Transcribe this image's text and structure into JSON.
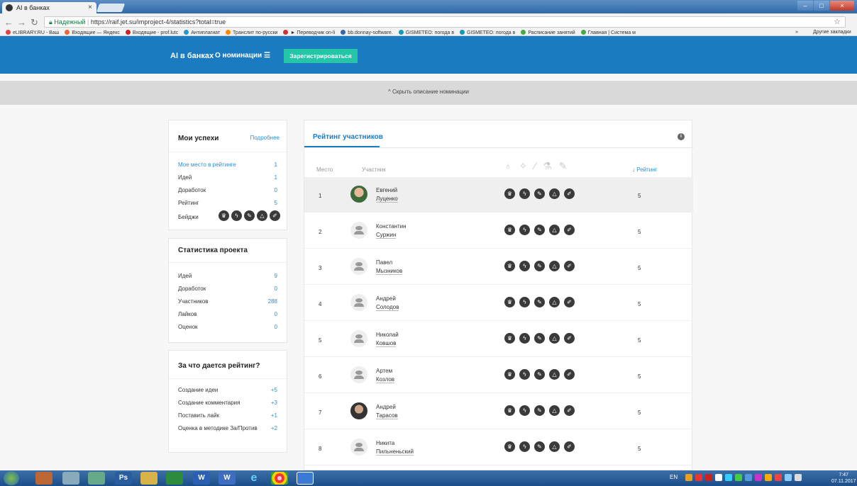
{
  "browser": {
    "tab_title": "AI в банках",
    "tab_close": "×",
    "url_secure_label": "Надежный",
    "url": "https://raif.jet.su/improject-4/statistics?total=true",
    "bookmarks": [
      {
        "label": "eLIBRARY.RU - Ваш",
        "color": "#d44"
      },
      {
        "label": "Входящие — Яндекс",
        "color": "#e63"
      },
      {
        "label": "Входящие - prof.lutc",
        "color": "#c22"
      },
      {
        "label": "Антиплагиат",
        "color": "#29c"
      },
      {
        "label": "Транслит по-русски",
        "color": "#f80"
      },
      {
        "label": "► Переводчик on-li",
        "color": "#c33"
      },
      {
        "label": "bb.donnay-software.",
        "color": "#36a"
      },
      {
        "label": "GISMETEO: погода в",
        "color": "#19b"
      },
      {
        "label": "GISMETEO: погода в",
        "color": "#19b"
      },
      {
        "label": "Расписание занятий",
        "color": "#4a4"
      },
      {
        "label": "Главная | Система м",
        "color": "#4a4"
      }
    ],
    "bookmarks_more": "»",
    "bookmarks_other": "Другие закладки"
  },
  "header": {
    "brand": "AI в банках",
    "nominations": "О номинации",
    "register": "Зарегистрироваться",
    "hide_description": "Скрыть описание номинации",
    "hide_arrow": "^"
  },
  "my_success": {
    "title": "Мои успехи",
    "more": "Подробнее",
    "rows": [
      {
        "label": "Мое место в рейтинге",
        "value": "1"
      },
      {
        "label": "Идей",
        "value": "1"
      },
      {
        "label": "Доработок",
        "value": "0"
      },
      {
        "label": "Рейтинг",
        "value": "5"
      }
    ],
    "badges_label": "Бейджи"
  },
  "stats": {
    "title": "Статистика проекта",
    "rows": [
      {
        "label": "Идей",
        "value": "9"
      },
      {
        "label": "Доработок",
        "value": "0"
      },
      {
        "label": "Участников",
        "value": "288"
      },
      {
        "label": "Лайков",
        "value": "0"
      },
      {
        "label": "Оценок",
        "value": "0"
      }
    ]
  },
  "rating_rules": {
    "title": "За что дается рейтинг?",
    "rows": [
      {
        "label": "Создание идеи",
        "value": "+5"
      },
      {
        "label": "Создание комментария",
        "value": "+3"
      },
      {
        "label": "Поставить лайк",
        "value": "+1"
      },
      {
        "label": "Оценка в методике За/Против",
        "value": "+2"
      }
    ]
  },
  "leaderboard": {
    "title": "Рейтинг участников",
    "info": "i",
    "col_place": "Место",
    "col_participant": "Участник",
    "col_rating": "↓ Рейтинг",
    "header_badges": "♁ ✧ ∕ ⚗ ✎",
    "badge_icons": [
      "trophy-icon",
      "bolt-icon",
      "pencil-icon",
      "flask-icon",
      "brush-icon"
    ],
    "rows": [
      {
        "place": "1",
        "first": "Евгений",
        "last": "Луценко",
        "rating": "5"
      },
      {
        "place": "2",
        "first": "Константин",
        "last": "Суржин",
        "rating": "5"
      },
      {
        "place": "3",
        "first": "Павел",
        "last": "Мызников",
        "rating": "5"
      },
      {
        "place": "4",
        "first": "Андрей",
        "last": "Солодов",
        "rating": "5"
      },
      {
        "place": "5",
        "first": "Николай",
        "last": "Ковшов",
        "rating": "5"
      },
      {
        "place": "6",
        "first": "Артем",
        "last": "Козлов",
        "rating": "5"
      },
      {
        "place": "7",
        "first": "Андрей",
        "last": "Тарасов",
        "rating": "5"
      },
      {
        "place": "8",
        "first": "Никита",
        "last": "Пильненьский",
        "rating": "5"
      }
    ]
  },
  "taskbar": {
    "lang": "EN",
    "time": "7:47",
    "date": "07.11.2017",
    "apps": [
      "Ps",
      "W",
      "W",
      "e"
    ]
  },
  "colors": {
    "brand_blue": "#1a7bc1",
    "accent_green": "#25c6a8",
    "link_blue": "#2b8fd3"
  }
}
